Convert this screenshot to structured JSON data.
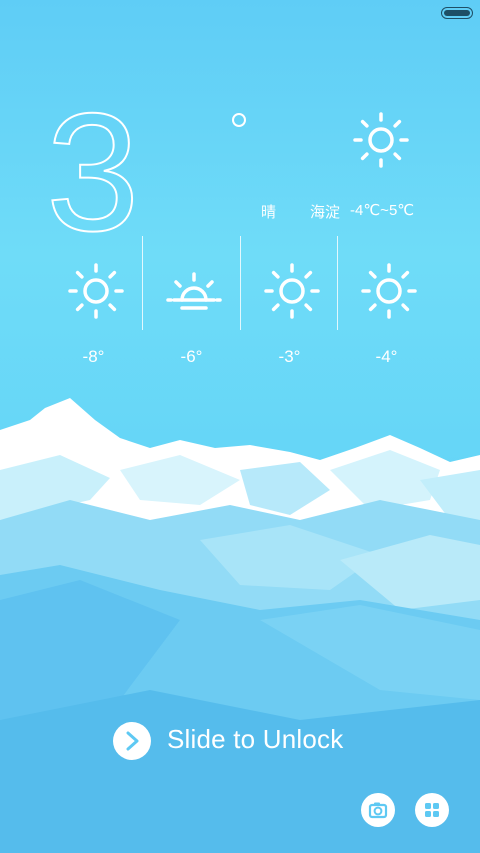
{
  "status_bar": {
    "battery_icon": "battery-icon"
  },
  "weather": {
    "current_temp": "3",
    "degree_symbol_icon": "degree-ring",
    "current_icon": "sun-icon",
    "condition": "晴",
    "city": "海淀",
    "range": "-4℃~5℃"
  },
  "forecast": [
    {
      "icon": "sun-icon",
      "temp": "-8°"
    },
    {
      "icon": "sunrise-icon",
      "temp": "-6°"
    },
    {
      "icon": "sun-icon",
      "temp": "-3°"
    },
    {
      "icon": "sun-icon",
      "temp": "-4°"
    }
  ],
  "unlock": {
    "label": "Slide to Unlock",
    "icon": "chevron-right-icon"
  },
  "shortcuts": {
    "camera_icon": "camera-icon",
    "apps_icon": "apps-grid-icon"
  },
  "colors": {
    "sky": "#66d6f7",
    "snow": "#ffffff",
    "status_dark": "#1e4f66"
  }
}
